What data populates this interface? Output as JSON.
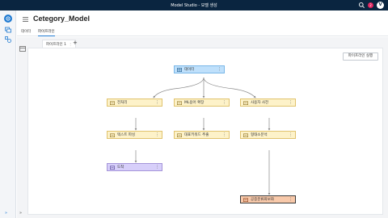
{
  "app": {
    "title": "Model Studio - 모델 생성",
    "notification_count": "2",
    "user_initial": "V"
  },
  "header": {
    "title": "Cetegory_Model"
  },
  "tabs": [
    {
      "label": "데이터"
    },
    {
      "label": "파이프라인"
    }
  ],
  "pipeline": {
    "tab_label": "파이프라인 1",
    "add_tab_label": "+",
    "run_label": "파이프라인 실행",
    "nodes": [
      {
        "id": "data",
        "label": "데이터"
      },
      {
        "id": "preprocess",
        "label": "전처리"
      },
      {
        "id": "ml",
        "label": "ML용어 확장"
      },
      {
        "id": "dict",
        "label": "사용자 사전"
      },
      {
        "id": "parse",
        "label": "텍스트 파싱"
      },
      {
        "id": "keyword",
        "label": "대표키워드 추출"
      },
      {
        "id": "morph",
        "label": "형태소분석"
      },
      {
        "id": "end",
        "label": "도착"
      },
      {
        "id": "classify",
        "label": "공중분류화보화"
      }
    ]
  },
  "colors": {
    "topbar": "#0a2540",
    "accent": "#1f7ad1",
    "node_fill": "#fdf2c9",
    "data_node_fill": "#bfe0fb",
    "end_node_fill": "#d7cffa",
    "selected_node_fill": "#f8c9aa"
  },
  "icons": {
    "search": "search-icon",
    "menu": "menu-icon",
    "node": "node-icon",
    "kebab": "kebab-icon"
  }
}
